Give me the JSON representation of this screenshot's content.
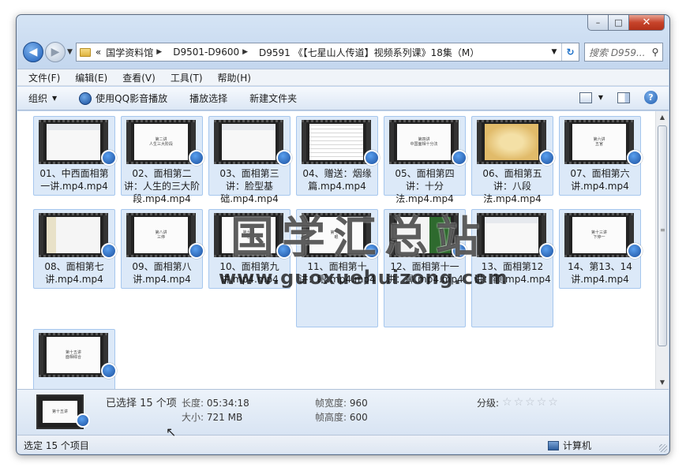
{
  "window": {
    "caption": {
      "minimize": "–",
      "maximize": "□",
      "close": "✕"
    }
  },
  "nav": {
    "back_glyph": "◀",
    "forward_glyph": "▶",
    "breadcrumb_prefix": "«",
    "breadcrumbs": [
      "国学资料馆",
      "D9501-D9600",
      "D9591 《【七星山人传道】视频系列课》18集（M）"
    ],
    "refresh_glyph": "↻",
    "search_placeholder": "搜索 D959..."
  },
  "menu": [
    "文件(F)",
    "编辑(E)",
    "查看(V)",
    "工具(T)",
    "帮助(H)"
  ],
  "commands": {
    "organize": "组织",
    "play_qq": "使用QQ影音播放",
    "play_selection": "播放选择",
    "new_folder": "新建文件夹",
    "help_glyph": "?"
  },
  "files": [
    {
      "name": "01、中西面相第一讲.mp4.mp4",
      "thumb": "ppt",
      "caption": ""
    },
    {
      "name": "02、面相第二讲：人生的三大阶段.mp4.mp4",
      "thumb": "white",
      "caption": "第二讲\n人生三大阶段"
    },
    {
      "name": "03、面相第三讲：脸型基础.mp4.mp4",
      "thumb": "ppt",
      "caption": ""
    },
    {
      "name": "04、赠送：烟缘篇.mp4.mp4",
      "thumb": "chart",
      "caption": ""
    },
    {
      "name": "05、面相第四讲：十分法.mp4.mp4",
      "thumb": "white",
      "caption": "第四讲\n中国面相十分法"
    },
    {
      "name": "06、面相第五讲：八段法.mp4.mp4",
      "thumb": "face",
      "caption": ""
    },
    {
      "name": "07、面相第六讲.mp4.mp4",
      "thumb": "white",
      "caption": "第六讲\n五官"
    },
    {
      "name": "08、面相第七讲.mp4.mp4",
      "thumb": "photo",
      "caption": ""
    },
    {
      "name": "09、面相第八讲.mp4.mp4",
      "thumb": "white",
      "caption": "第八讲\n三停"
    },
    {
      "name": "10、面相第九讲.mp4.mp4",
      "thumb": "white",
      "caption": "第九讲\n眉"
    },
    {
      "name": "11、面相第十讲：眼.mp4.mp4",
      "thumb": "white",
      "caption": "第十讲\n眼"
    },
    {
      "name": "12、面相第十一讲：鼻.mp4.mp4",
      "thumb": "dark",
      "caption": ""
    },
    {
      "name": "13、面相第12讲：颧.mp4.mp4",
      "thumb": "ppt",
      "caption": ""
    },
    {
      "name": "14、第13、14讲.mp4.mp4",
      "thumb": "white",
      "caption": "第十三讲\n下停一"
    },
    {
      "name": "",
      "thumb": "white",
      "caption": "第十五讲\n面相综合"
    }
  ],
  "watermark": {
    "title": "国学汇总站",
    "url": "www.guoxuehuizong.com"
  },
  "details": {
    "selected": "已选择 15 个项",
    "length_label": "长度:",
    "length_value": "05:34:18",
    "size_label": "大小:",
    "size_value": "721 MB",
    "width_label": "帧宽度:",
    "width_value": "960",
    "height_label": "帧高度:",
    "height_value": "600",
    "rating_label": "分级:",
    "rating_stars": 0,
    "thumb_caption": "第十五讲"
  },
  "status": {
    "left": "选定 15 个项目",
    "computer": "计算机"
  }
}
